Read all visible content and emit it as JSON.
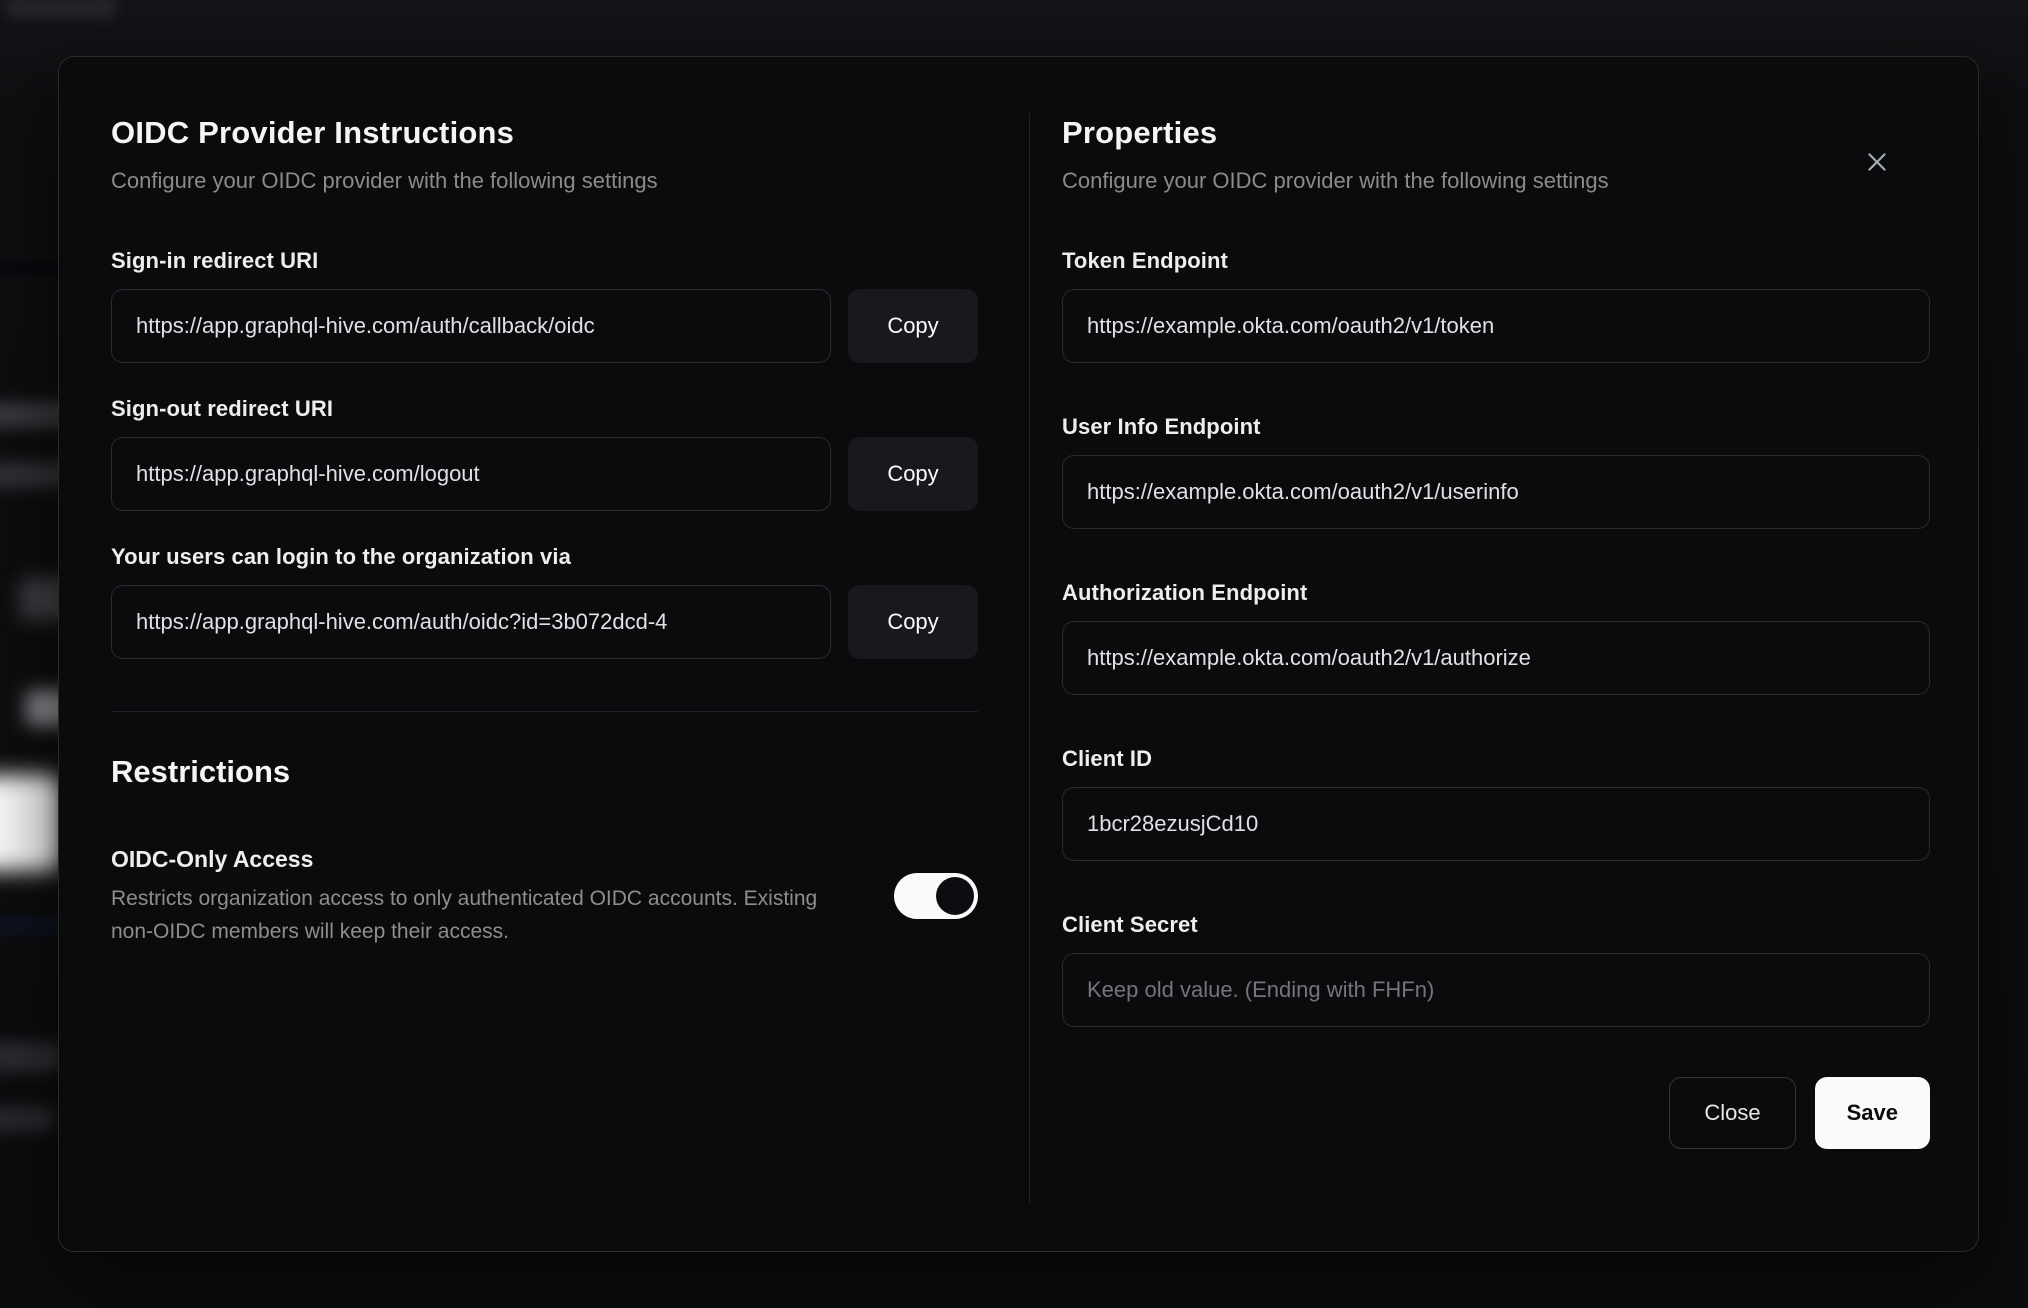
{
  "modal": {
    "close_icon": "x",
    "instructions": {
      "title": "OIDC Provider Instructions",
      "subtitle": "Configure your OIDC provider with the following settings",
      "fields": [
        {
          "label": "Sign-in redirect URI",
          "value": "https://app.graphql-hive.com/auth/callback/oidc",
          "copy_label": "Copy"
        },
        {
          "label": "Sign-out redirect URI",
          "value": "https://app.graphql-hive.com/logout",
          "copy_label": "Copy"
        },
        {
          "label": "Your users can login to the organization via",
          "value": "https://app.graphql-hive.com/auth/oidc?id=3b072dcd-4",
          "copy_label": "Copy"
        }
      ],
      "restrictions": {
        "title": "Restrictions",
        "toggle_label": "OIDC-Only Access",
        "toggle_description": "Restricts organization access to only authenticated OIDC accounts. Existing non-OIDC members will keep their access.",
        "toggle_state": "on"
      }
    },
    "properties": {
      "title": "Properties",
      "subtitle": "Configure your OIDC provider with the following settings",
      "fields": [
        {
          "label": "Token Endpoint",
          "value": "https://example.okta.com/oauth2/v1/token"
        },
        {
          "label": "User Info Endpoint",
          "value": "https://example.okta.com/oauth2/v1/userinfo"
        },
        {
          "label": "Authorization Endpoint",
          "value": "https://example.okta.com/oauth2/v1/authorize"
        },
        {
          "label": "Client ID",
          "value": "1bcr28ezusjCd10"
        },
        {
          "label": "Client Secret",
          "value": "",
          "placeholder": "Keep old value. (Ending with FHFn)"
        }
      ],
      "footer": {
        "close_label": "Close",
        "save_label": "Save"
      }
    },
    "colors": {
      "save_bg": "#fafafa",
      "save_text": "#0b0c0e",
      "toggle_track": "#fafafa",
      "toggle_knob": "#0b0d10"
    }
  }
}
